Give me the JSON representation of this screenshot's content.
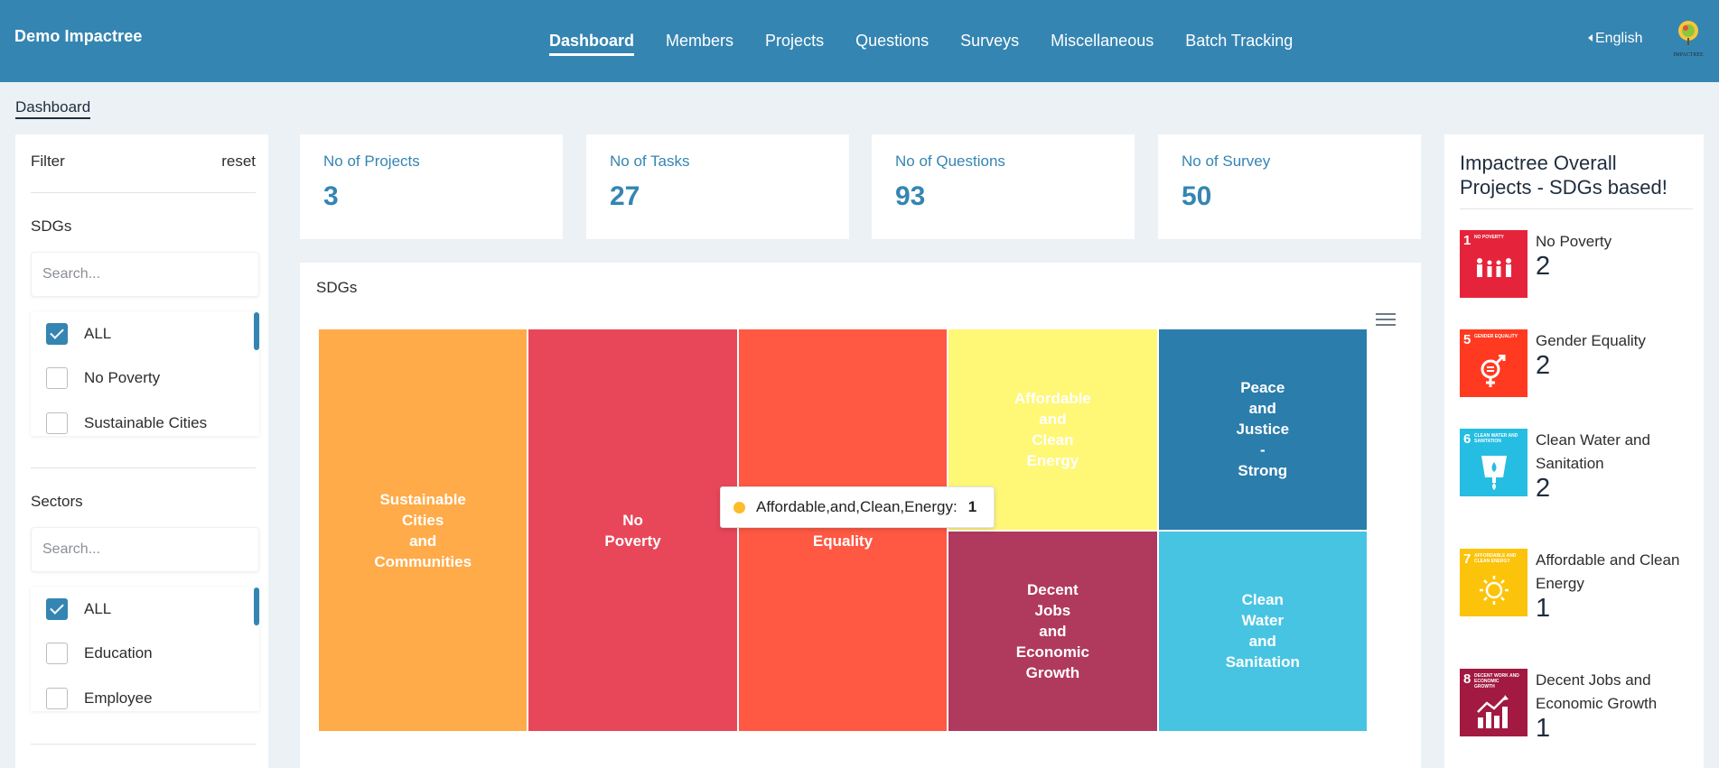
{
  "header": {
    "brand": "Demo Impactree",
    "nav": [
      "Dashboard",
      "Members",
      "Projects",
      "Questions",
      "Surveys",
      "Miscellaneous",
      "Batch Tracking"
    ],
    "active_nav": "Dashboard",
    "language": "English",
    "logo_text": "IMPACTREE"
  },
  "breadcrumb": "Dashboard",
  "filter": {
    "title": "Filter",
    "reset": "reset",
    "sdgs": {
      "title": "SDGs",
      "placeholder": "Search...",
      "options": [
        {
          "label": "ALL",
          "checked": true
        },
        {
          "label": "No Poverty",
          "checked": false
        },
        {
          "label": "Sustainable Cities",
          "checked": false
        }
      ]
    },
    "sectors": {
      "title": "Sectors",
      "placeholder": "Search...",
      "options": [
        {
          "label": "ALL",
          "checked": true
        },
        {
          "label": "Education",
          "checked": false
        },
        {
          "label": "Employee",
          "checked": false
        }
      ]
    }
  },
  "stats": [
    {
      "label": "No of Projects",
      "value": "3"
    },
    {
      "label": "No of Tasks",
      "value": "27"
    },
    {
      "label": "No of Questions",
      "value": "93"
    },
    {
      "label": "No of Survey",
      "value": "50"
    }
  ],
  "sdg_panel": {
    "title": "SDGs",
    "tooltip": {
      "label": "Affordable,and,Clean,Energy:",
      "value": "1",
      "color": "#febb2b"
    }
  },
  "chart_data": {
    "type": "treemap",
    "title": "SDGs",
    "series": [
      {
        "name": "Sustainable\nCities\nand\nCommunities",
        "value": 2,
        "color": "#ffab49"
      },
      {
        "name": "No\nPoverty",
        "value": 2,
        "color": "#e84759"
      },
      {
        "name": "Gender\nEquality",
        "value": 2,
        "color": "#ff5843"
      },
      {
        "name": "Affordable\nand\nClean\nEnergy",
        "value": 1,
        "color": "#fff776"
      },
      {
        "name": "Decent\nJobs\nand\nEconomic\nGrowth",
        "value": 1,
        "color": "#b0395e"
      },
      {
        "name": "Peace\nand\nJustice\n-\nStrong",
        "value": 1,
        "color": "#2b7dab"
      },
      {
        "name": "Clean\nWater\nand\nSanitation",
        "value": 1,
        "color": "#48c4e3"
      }
    ]
  },
  "overall": {
    "title": "Impactree Overall Projects - SDGs based!",
    "items": [
      {
        "num": "1",
        "tile_text": "NO POVERTY",
        "name": "No Poverty",
        "count": "2",
        "color": "#e5243b",
        "icon": "people-icon"
      },
      {
        "num": "5",
        "tile_text": "GENDER EQUALITY",
        "name": "Gender Equality",
        "count": "2",
        "color": "#ff3a21",
        "icon": "gender-icon"
      },
      {
        "num": "6",
        "tile_text": "CLEAN WATER AND SANITATION",
        "name": "Clean Water and Sanitation",
        "count": "2",
        "color": "#26bde2",
        "icon": "water-icon"
      },
      {
        "num": "7",
        "tile_text": "AFFORDABLE AND CLEAN ENERGY",
        "name": "Affordable and Clean Energy",
        "count": "1",
        "color": "#fcc30b",
        "icon": "sun-icon"
      },
      {
        "num": "8",
        "tile_text": "DECENT WORK AND ECONOMIC GROWTH",
        "name": "Decent Jobs and Economic Growth",
        "count": "1",
        "color": "#a21942",
        "icon": "growth-chart-icon"
      }
    ]
  }
}
